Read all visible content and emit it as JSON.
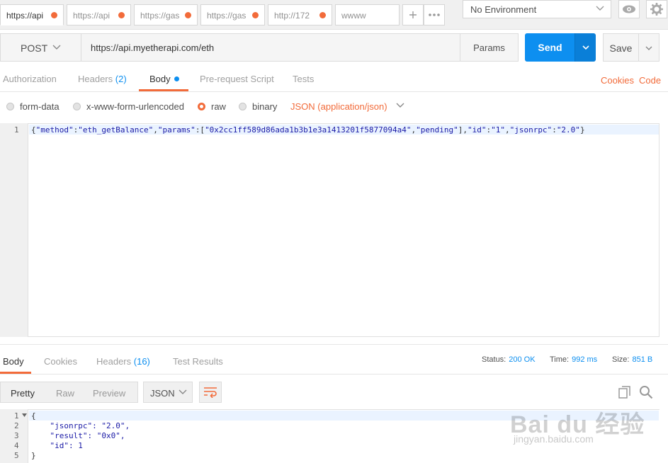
{
  "tabs": [
    {
      "label": "https://api",
      "active": true
    },
    {
      "label": "https://api"
    },
    {
      "label": "https://gas"
    },
    {
      "label": "https://gas"
    },
    {
      "label": "http://172"
    },
    {
      "label": "wwww"
    }
  ],
  "environment": {
    "selected": "No Environment"
  },
  "request": {
    "method": "POST",
    "url": "https://api.myetherapi.com/eth",
    "params_label": "Params",
    "send_label": "Send",
    "save_label": "Save"
  },
  "request_tabs": {
    "authorization": "Authorization",
    "headers": "Headers",
    "headers_count": "(2)",
    "body": "Body",
    "prerequest": "Pre-request Script",
    "tests": "Tests",
    "cookies": "Cookies",
    "code": "Code"
  },
  "body_modes": {
    "form_data": "form-data",
    "urlencoded": "x-www-form-urlencoded",
    "raw": "raw",
    "binary": "binary",
    "content_type": "JSON (application/json)",
    "selected": "raw"
  },
  "request_body": {
    "line_numbers": [
      "1"
    ],
    "tokens": [
      "{",
      "\"method\"",
      ":",
      "\"eth_getBalance\"",
      ",",
      "\"params\"",
      ":[",
      "\"0x2cc1ff589d86ada1b3b1e3a1413201f5877094a4\"",
      ",",
      "\"pending\"",
      "],",
      "\"id\"",
      ":",
      "\"1\"",
      ",",
      "\"jsonrpc\"",
      ":",
      "\"2.0\"",
      "}"
    ]
  },
  "response_tabs": {
    "body": "Body",
    "cookies": "Cookies",
    "headers": "Headers",
    "headers_count": "(16)",
    "test_results": "Test Results"
  },
  "response_status": {
    "status_label": "Status:",
    "status_value": "200 OK",
    "time_label": "Time:",
    "time_value": "992 ms",
    "size_label": "Size:",
    "size_value": "851 B"
  },
  "response_view": {
    "pretty": "Pretty",
    "raw": "Raw",
    "preview": "Preview",
    "format": "JSON"
  },
  "response_body": {
    "line_numbers": [
      "1",
      "2",
      "3",
      "4",
      "5"
    ],
    "lines": [
      "{",
      "    \"jsonrpc\": \"2.0\",",
      "    \"result\": \"0x0\",",
      "    \"id\": 1",
      "}"
    ]
  },
  "watermark": {
    "main": "Bai du 经验",
    "sub": "jingyan.baidu.com"
  },
  "colors": {
    "accent": "#f26b3a",
    "primary": "#0d8ff0"
  }
}
